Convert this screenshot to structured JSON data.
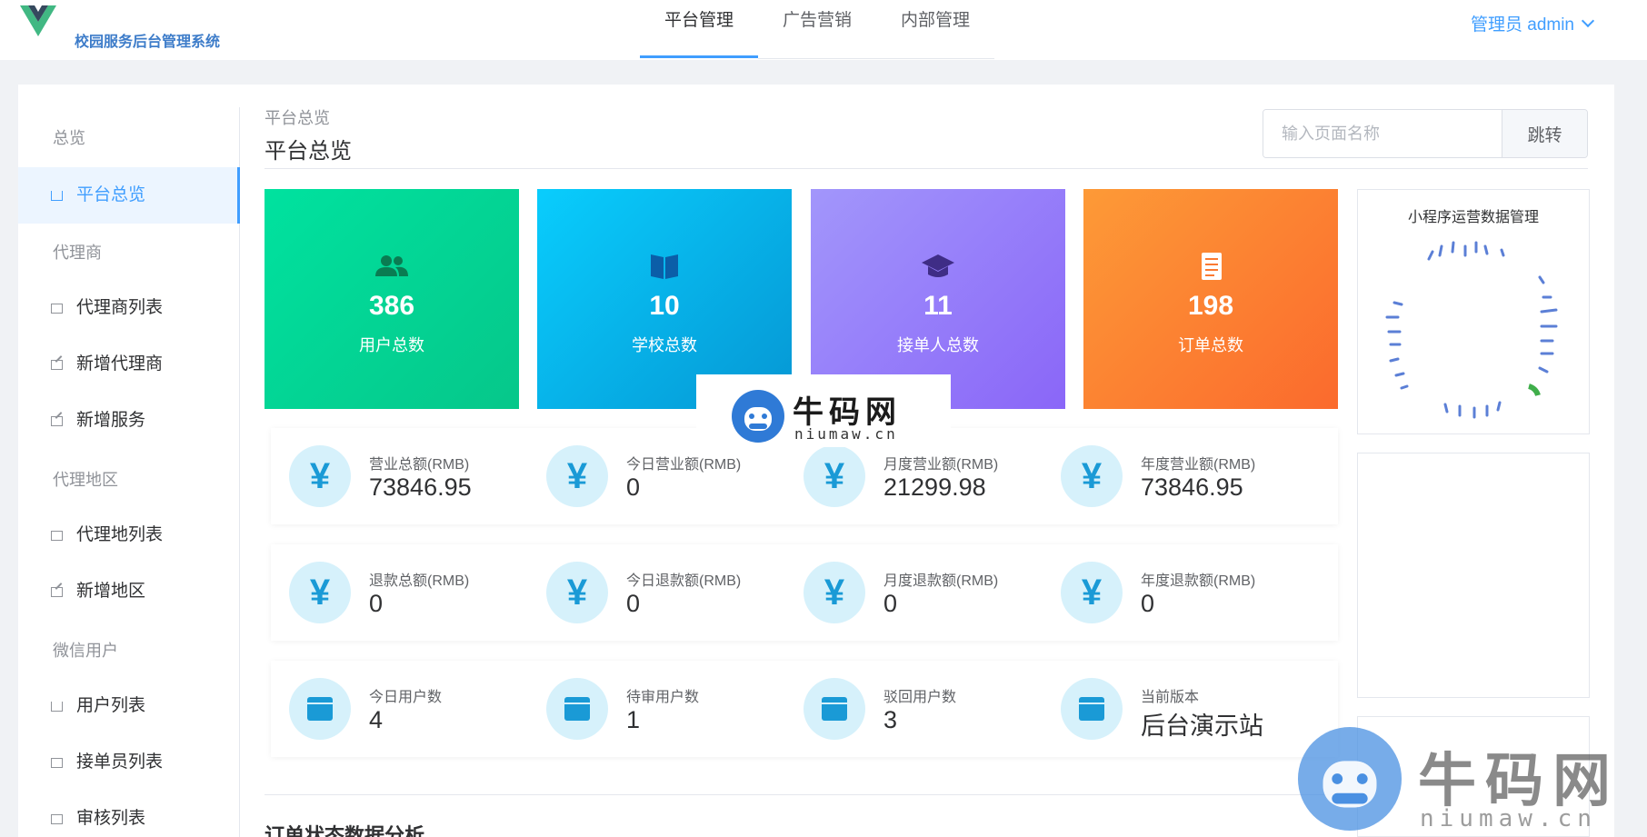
{
  "header": {
    "brand": "校园服务后台管理系统",
    "tabs": [
      "平台管理",
      "广告营销",
      "内部管理"
    ],
    "admin_label": "管理员 admin"
  },
  "sidebar": {
    "groups": [
      "总览",
      "代理商",
      "代理地区",
      "微信用户"
    ],
    "items": [
      "平台总览",
      "代理商列表",
      "新增代理商",
      "新增服务",
      "代理地列表",
      "新增地区",
      "用户列表",
      "接单员列表",
      "审核列表"
    ]
  },
  "page": {
    "breadcrumb": "平台总览",
    "title": "平台总览",
    "search_placeholder": "输入页面名称",
    "search_button": "跳转",
    "section_title": "订单状态数据分析"
  },
  "tiles": [
    {
      "value": "386",
      "label": "用户总数",
      "icon": "users-icon",
      "color1": "#00e29f",
      "color2": "#06c78a"
    },
    {
      "value": "10",
      "label": "学校总数",
      "icon": "book-icon",
      "color1": "#09cdfd",
      "color2": "#0597d4"
    },
    {
      "value": "11",
      "label": "接单人总数",
      "icon": "graduation-cap-icon",
      "color1": "#a296fb",
      "color2": "#8a66f8"
    },
    {
      "value": "198",
      "label": "订单总数",
      "icon": "document-icon",
      "color1": "#fd9a37",
      "color2": "#fb6a2d"
    }
  ],
  "revenue": [
    {
      "label": "营业总额(RMB)",
      "value": "73846.95"
    },
    {
      "label": "今日营业额(RMB)",
      "value": "0"
    },
    {
      "label": "月度营业额(RMB)",
      "value": "21299.98"
    },
    {
      "label": "年度营业额(RMB)",
      "value": "73846.95"
    }
  ],
  "refunds": [
    {
      "label": "退款总额(RMB)",
      "value": "0"
    },
    {
      "label": "今日退款额(RMB)",
      "value": "0"
    },
    {
      "label": "月度退款额(RMB)",
      "value": "0"
    },
    {
      "label": "年度退款额(RMB)",
      "value": "0"
    }
  ],
  "users": [
    {
      "label": "今日用户数",
      "value": "4"
    },
    {
      "label": "待审用户数",
      "value": "1"
    },
    {
      "label": "驳回用户数",
      "value": "3"
    },
    {
      "label": "当前版本",
      "value": "后台演示站"
    }
  ],
  "right_panel": {
    "title": "小程序运营数据管理"
  },
  "watermark": {
    "text": "牛码网",
    "url": "niumaw.cn"
  }
}
